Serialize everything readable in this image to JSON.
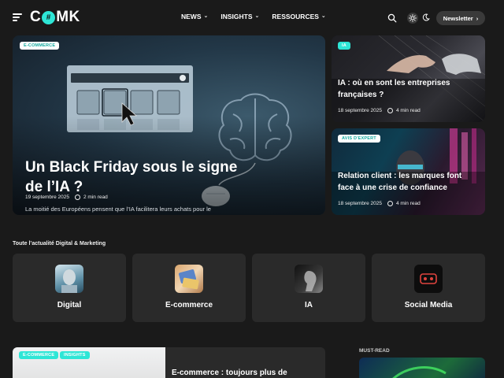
{
  "header": {
    "logo": {
      "part1": "C",
      "mark": "#",
      "part2": "MK"
    },
    "nav": [
      {
        "label": "NEWS"
      },
      {
        "label": "INSIGHTS"
      },
      {
        "label": "RESSOURCES"
      }
    ],
    "newsletter_label": "Newsletter",
    "accent_color": "#2ee6d6"
  },
  "hero": {
    "badge": "E-COMMERCE",
    "title": "Un Black Friday sous le signe de l’IA ?",
    "excerpt": "La moitié des Européens pensent que l’IA facilitera leurs achats pour le Black Friday mais restent prudents sur les questions de vie privée...",
    "date": "19 septembre 2025",
    "read_time": "2 min read",
    "image_badge_count": "3"
  },
  "side_cards": [
    {
      "badge": "IA",
      "title": "IA : où en sont les entreprises françaises ?",
      "date": "18 septembre 2025",
      "read_time": "4 min read"
    },
    {
      "badge": "AVIS D'EXPERT",
      "title": "Relation client : les marques font face à une crise de confiance",
      "date": "18 septembre 2025",
      "read_time": "4 min read"
    }
  ],
  "categories_section": {
    "label": "Toute l’actualité Digital & Marketing",
    "items": [
      {
        "label": "Digital"
      },
      {
        "label": "E-commerce"
      },
      {
        "label": "IA"
      },
      {
        "label": "Social Media"
      }
    ]
  },
  "bottom": {
    "badges": [
      "E-COMMERCE",
      "INSIGHTS"
    ],
    "title": "E-commerce : toujours plus de",
    "must_read_label": "MUST-READ"
  }
}
